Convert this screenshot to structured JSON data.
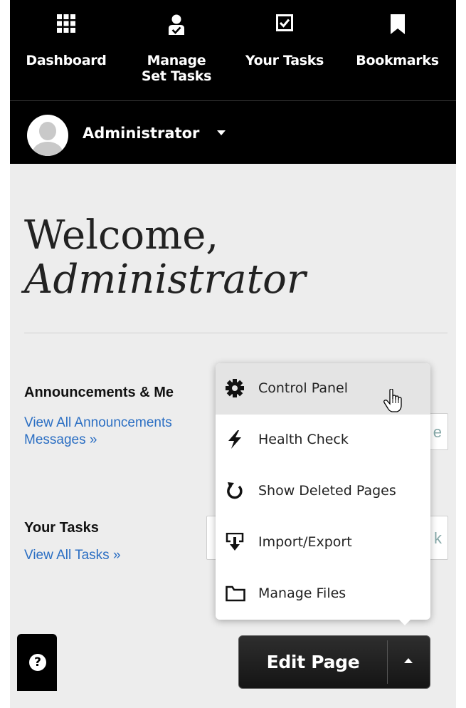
{
  "nav": {
    "items": [
      {
        "label": "Dashboard",
        "icon": "grid-icon"
      },
      {
        "label": "Manage\nSet Tasks",
        "icon": "user-task-icon"
      },
      {
        "label": "Your Tasks",
        "icon": "checkbox-icon"
      },
      {
        "label": "Bookmarks",
        "icon": "bookmark-icon"
      }
    ]
  },
  "user": {
    "name": "Administrator"
  },
  "welcome": {
    "line1": "Welcome,",
    "line2": "Administrator"
  },
  "sections": {
    "announcements": {
      "title": "Announcements & Me",
      "link": "View All Announcements\nMessages »",
      "box_text": "e"
    },
    "tasks": {
      "title": "Your Tasks",
      "link": "View All Tasks »",
      "box_text": "k"
    }
  },
  "menu": {
    "items": [
      {
        "label": "Control Panel",
        "icon": "gear-icon"
      },
      {
        "label": "Health Check",
        "icon": "lightning-icon"
      },
      {
        "label": "Show Deleted Pages",
        "icon": "refresh-icon"
      },
      {
        "label": "Import/Export",
        "icon": "import-export-icon"
      },
      {
        "label": "Manage Files",
        "icon": "folder-icon"
      }
    ]
  },
  "help": {
    "symbol": "?"
  },
  "edit": {
    "label": "Edit Page"
  }
}
